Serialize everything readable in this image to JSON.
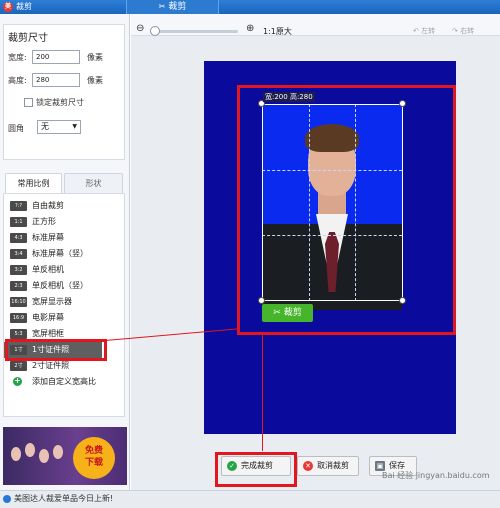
{
  "app": {
    "title": "裁剪",
    "tab_label": "裁剪",
    "tab_icon": "✂"
  },
  "left_panel": {
    "section_title": "裁剪尺寸",
    "width_label": "宽度:",
    "width_value": "200",
    "width_unit": "像素",
    "height_label": "高度:",
    "height_value": "280",
    "height_unit": "像素",
    "lock_label": "锁定裁剪尺寸",
    "corner_label": "圆角",
    "corner_value": "无",
    "tabs": [
      "常用比例",
      "形状"
    ],
    "ratios": [
      {
        "icon": "?:?",
        "label": "自由裁剪"
      },
      {
        "icon": "1:1",
        "label": "正方形"
      },
      {
        "icon": "4:3",
        "label": "标准屏幕"
      },
      {
        "icon": "3:4",
        "label": "标准屏幕（竖）"
      },
      {
        "icon": "3:2",
        "label": "单反相机"
      },
      {
        "icon": "2:3",
        "label": "单反相机（竖）"
      },
      {
        "icon": "16:10",
        "label": "宽屏显示器"
      },
      {
        "icon": "16:9",
        "label": "电影屏幕"
      },
      {
        "icon": "5:3",
        "label": "宽屏相框"
      },
      {
        "icon": "1寸",
        "label": "1寸证件照"
      },
      {
        "icon": "2寸",
        "label": "2寸证件照"
      }
    ],
    "add_custom_label": "添加自定义宽高比",
    "ad": {
      "line1": "免费",
      "line2": "下载"
    }
  },
  "toolbar": {
    "zoom_text": "1:1原大",
    "rotate_left": "↶ 左转",
    "rotate_right": "↷ 右转"
  },
  "canvas": {
    "size_label": "宽:200 高:280",
    "crop_button": "裁剪"
  },
  "buttons": {
    "finish": "完成裁剪",
    "cancel": "取消裁剪",
    "save": "保存"
  },
  "statusbar": {
    "text": "美图达人裁爱单品今日上新!"
  },
  "watermark": "Bai 经验  jingyan.baidu.com",
  "colors": {
    "accent_red": "#e1161e",
    "canvas_bg": "#0a0a9c",
    "photo_bg": "#0b2af0",
    "crop_green": "#47b52c"
  }
}
